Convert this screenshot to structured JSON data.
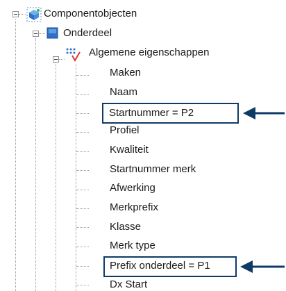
{
  "tree": {
    "root": {
      "label": "Componentobjecten",
      "icon": "component-objects-icon"
    },
    "child": {
      "label": "Onderdeel",
      "icon": "part-square-icon"
    },
    "group": {
      "label": "Algemene eigenschappen",
      "icon": "general-properties-icon"
    },
    "items": [
      {
        "label": "Maken"
      },
      {
        "label": "Naam"
      },
      {
        "label": "Startnummer = P2"
      },
      {
        "label": "Profiel"
      },
      {
        "label": "Kwaliteit"
      },
      {
        "label": "Startnummer merk"
      },
      {
        "label": "Afwerking"
      },
      {
        "label": "Merkprefix"
      },
      {
        "label": "Klasse"
      },
      {
        "label": "Merk type"
      },
      {
        "label": "Prefix onderdeel = P1"
      },
      {
        "label": "Dx Start"
      }
    ]
  },
  "annotations": {
    "highlight_color": "#0d3a66",
    "arrow_color": "#0d3a66",
    "highlighted_items": [
      "Startnummer = P2",
      "Prefix onderdeel = P1"
    ]
  }
}
